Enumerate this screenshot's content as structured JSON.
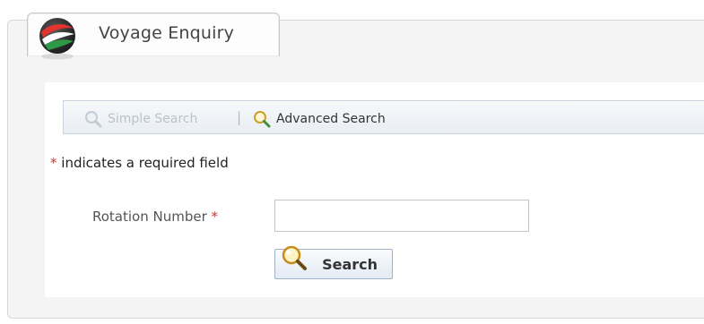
{
  "tab": {
    "title": "Voyage Enquiry",
    "logo_icon": "globe-logo-icon"
  },
  "search_bar": {
    "simple_search": "Simple Search",
    "separator": "|",
    "advanced_search": "Advanced Search",
    "search_icon": "magnifier-icon"
  },
  "form": {
    "required_star": "*",
    "required_note": "indicates a required field",
    "rotation_label": "Rotation Number",
    "rotation_value": "",
    "search_button": "Search"
  },
  "colors": {
    "accent_red": "#d3302f",
    "disabled_text": "#b9c2cc",
    "bar_border": "#c9d3dd"
  }
}
